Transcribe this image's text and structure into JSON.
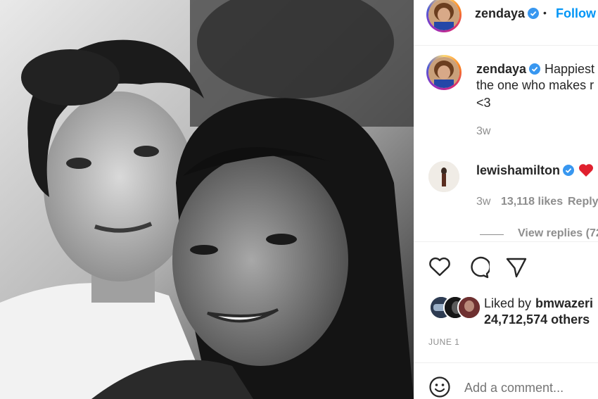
{
  "post_header": {
    "username": "zendaya",
    "separator": "•",
    "follow_label": "Follow"
  },
  "caption": {
    "username": "zendaya",
    "line1": "Happiest",
    "line2": "the one who makes r",
    "line3": "<3",
    "time": "3w"
  },
  "comment": {
    "username": "lewishamilton",
    "time": "3w",
    "likes": "13,118 likes",
    "reply_label": "Reply",
    "view_replies": "View replies (72"
  },
  "likes": {
    "prefix": "Liked by",
    "user": "bmwazeri",
    "others": "24,712,574 others"
  },
  "date": "JUNE 1",
  "add_comment": {
    "placeholder": "Add a comment..."
  },
  "colors": {
    "link_blue": "#0095f6",
    "verified_blue": "#3897f0",
    "heart_red": "#ed4956"
  }
}
